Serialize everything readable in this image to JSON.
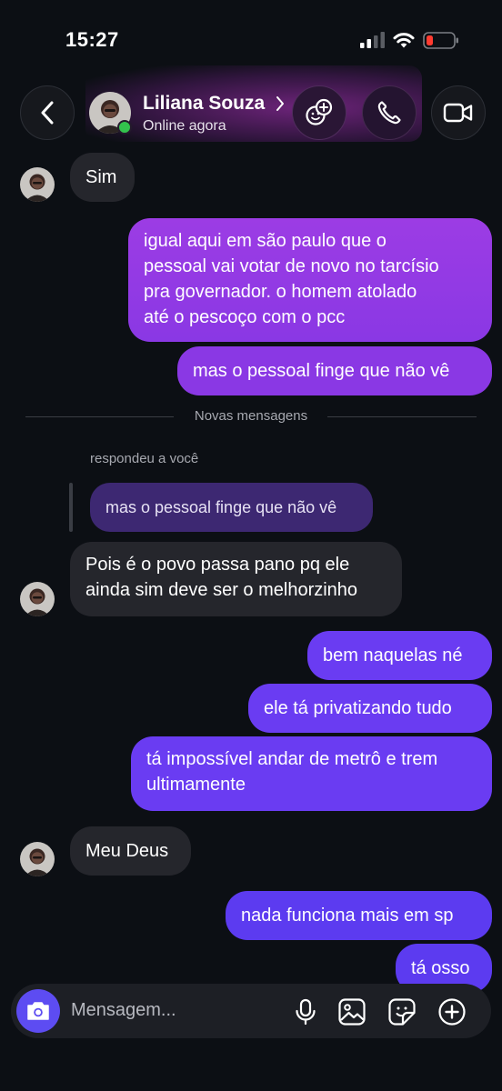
{
  "status_bar": {
    "time": "15:27"
  },
  "header": {
    "contact_name": "Liliana Souza",
    "contact_status": "Online agora"
  },
  "thread": {
    "msg_sim": "Sim",
    "msg_igual_lines": [
      "igual aqui em são paulo que o",
      "pessoal vai votar de novo no tarcísio",
      "pra governador. o homem atolado",
      "até o pescoço com o pcc"
    ],
    "msg_finge": "mas o pessoal finge que não vê",
    "divider_label": "Novas mensagens",
    "reply_label": "respondeu a você",
    "quoted_text": "mas o pessoal finge que não vê",
    "msg_pois_lines": [
      "Pois é o povo passa pano pq ele",
      "ainda sim deve ser o melhorzinho"
    ],
    "msg_bem": "bem naquelas né",
    "msg_privatizando": "ele tá privatizando tudo",
    "msg_impossivel_lines": [
      "tá impossível andar de metrô e trem",
      "ultimamente"
    ],
    "msg_meu_deus": "Meu Deus",
    "msg_nada": "nada funciona mais em sp",
    "msg_osso": "tá osso"
  },
  "composer": {
    "placeholder": "Mensagem..."
  },
  "colors": {
    "background": "#0c0f14",
    "incoming_bubble": "#25262c",
    "outgoing_purple": "#9c3ce4",
    "outgoing_violet": "#6a3cf2",
    "camera_button": "#5d4cf2",
    "online_dot": "#33c24d"
  },
  "icons": [
    "back-chevron-icon",
    "avatar-swap-icon",
    "phone-icon",
    "video-icon",
    "camera-icon",
    "microphone-icon",
    "gallery-icon",
    "sticker-icon",
    "add-icon"
  ]
}
